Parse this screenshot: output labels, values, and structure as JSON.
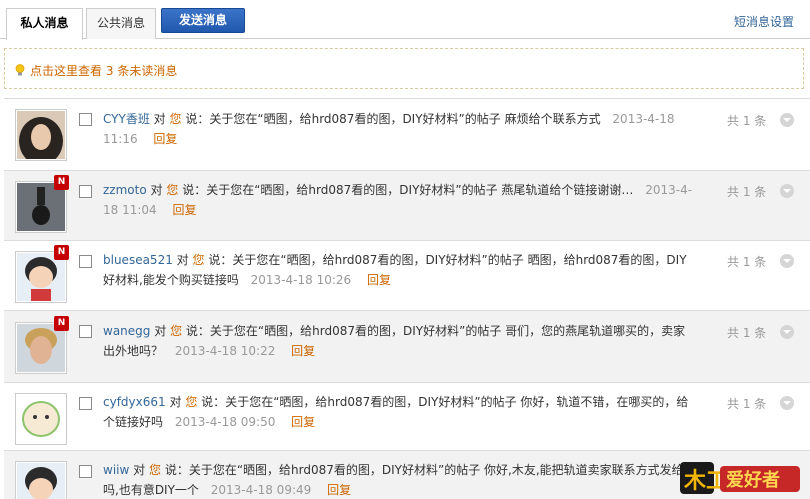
{
  "tabs": {
    "private": "私人消息",
    "public": "公共消息",
    "send": "发送消息",
    "settings": "短消息设置"
  },
  "notice": {
    "prefix": "点击这里查看",
    "count": "3",
    "suffix": "条未读消息"
  },
  "messages": [
    {
      "user": "CYY香班",
      "dui": "对",
      "you": "您",
      "shuo": "说：",
      "text": "关于您在“晒图，给hrd087看的图，DIY好材料”的帖子 麻烦给个联系方式",
      "time": "2013-4-18 11:16",
      "reply": "回复",
      "count": "共 1 条",
      "new_badge": ""
    },
    {
      "user": "zzmoto",
      "dui": "对",
      "you": "您",
      "shuo": "说：",
      "text": "关于您在“晒图，给hrd087看的图，DIY好材料”的帖子 燕尾轨道给个链接谢谢…",
      "time": "2013-4-18 11:04",
      "reply": "回复",
      "count": "共 1 条",
      "new_badge": "N"
    },
    {
      "user": "bluesea521",
      "dui": "对",
      "you": "您",
      "shuo": "说：",
      "text": "关于您在“晒图，给hrd087看的图，DIY好材料”的帖子 晒图，给hrd087看的图，DIY好材料,能发个购买链接吗",
      "time": "2013-4-18 10:26",
      "reply": "回复",
      "count": "共 1 条",
      "new_badge": "N"
    },
    {
      "user": "wanegg",
      "dui": "对",
      "you": "您",
      "shuo": "说：",
      "text": "关于您在“晒图，给hrd087看的图，DIY好材料”的帖子 哥们，您的燕尾轨道哪买的，卖家出外地吗？",
      "time": "2013-4-18 10:22",
      "reply": "回复",
      "count": "共 1 条",
      "new_badge": "N"
    },
    {
      "user": "cyfdyx661",
      "dui": "对",
      "you": "您",
      "shuo": "说：",
      "text": "关于您在“晒图，给hrd087看的图，DIY好材料”的帖子 你好，轨道不错，在哪买的，给个链接好吗",
      "time": "2013-4-18 09:50",
      "reply": "回复",
      "count": "共 1 条",
      "new_badge": ""
    },
    {
      "user": "wiiw",
      "dui": "对",
      "you": "您",
      "shuo": "说：",
      "text": "关于您在“晒图，给hrd087看的图，DIY好材料”的帖子 你好,木友,能把轨道卖家联系方式发给吗,也有意DIY一个",
      "time": "2013-4-18 09:49",
      "reply": "回复",
      "count": "",
      "new_badge": ""
    }
  ],
  "watermark": "木工爱好者",
  "colors": {
    "link": "#336699",
    "accent": "#cc6600",
    "send_button": "#2a64b8",
    "badge": "#c40000"
  }
}
